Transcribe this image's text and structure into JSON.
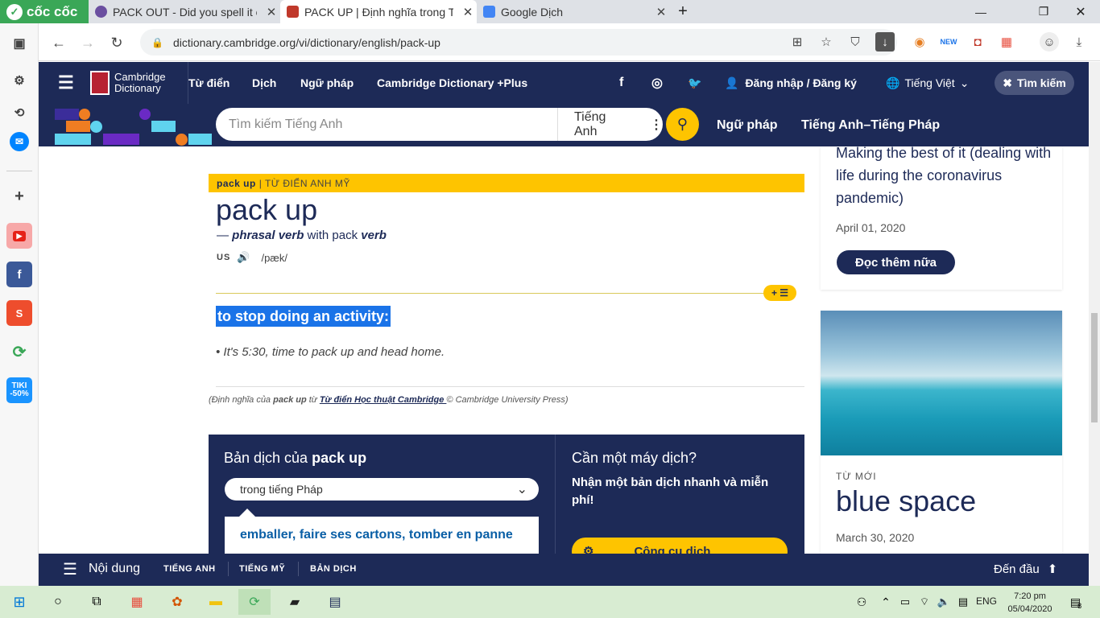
{
  "browser": {
    "brand": "cốc cốc",
    "tabs": [
      {
        "title": "PACK OUT - Did you spell it c"
      },
      {
        "title": "PACK UP | Định nghĩa trong T"
      },
      {
        "title": "Google Dịch"
      }
    ],
    "new_tab": "+",
    "url": "dictionary.cambridge.org/vi/dictionary/english/pack-up"
  },
  "site": {
    "logo_line1": "Cambridge",
    "logo_line2": "Dictionary",
    "nav": [
      "Từ điển",
      "Dịch",
      "Ngữ pháp",
      "Cambridge Dictionary +Plus"
    ],
    "login": "Đăng nhập / Đăng ký",
    "language": "Tiếng Việt",
    "search_toggle": "Tìm kiếm",
    "search_placeholder": "Tìm kiếm Tiếng Anh",
    "search_lang": "Tiếng Anh",
    "nav2": [
      "Ngữ pháp",
      "Tiếng Anh–Tiếng Pháp"
    ]
  },
  "entry": {
    "header_word": "pack up",
    "header_dict": "| TỪ ĐIỂN ANH MỸ",
    "headword": "pack up",
    "pos_prefix": "— ",
    "pos": "phrasal verb",
    "pos_with": " with pack ",
    "pos_verb": "verb",
    "region": "US",
    "ipa": "/pæk/",
    "definition": "to stop doing an activity:",
    "example": "• It's 5:30, time to pack up and head home.",
    "cite_pre": "(Định nghĩa của ",
    "cite_word": "pack up",
    "cite_mid": " từ ",
    "cite_link": "Từ điển Học thuật Cambridge ",
    "cite_post": "© Cambridge University Press)"
  },
  "translation": {
    "title_pre": "Bản dịch của ",
    "title_word": "pack up",
    "select": "trong tiếng Pháp",
    "result": "emballer, faire ses cartons, tomber en panne",
    "promo_title": "Cần một máy dịch?",
    "promo_text": "Nhận một bản dịch nhanh và miễn phí!",
    "promo_btn": "Công cụ dịch"
  },
  "sidebar": {
    "blog_title": "Making the best of it (dealing with life during the coronavirus pandemic)",
    "blog_date": "April 01, 2020",
    "read_more": "Đọc thêm nữa",
    "new_label": "TỪ MỚI",
    "new_word": "blue space",
    "new_date": "March 30, 2020"
  },
  "bottom": {
    "menu": "Nội dung",
    "links": [
      "TIẾNG ANH",
      "TIẾNG MỸ",
      "BẢN DỊCH"
    ],
    "top": "Đến đầu"
  },
  "taskbar": {
    "lang": "ENG",
    "time": "7:20 pm",
    "date": "05/04/2020",
    "notif": "8"
  },
  "colors": {
    "navy": "#1d2a57",
    "yellow": "#fec400",
    "highlight": "#1a73e8"
  }
}
